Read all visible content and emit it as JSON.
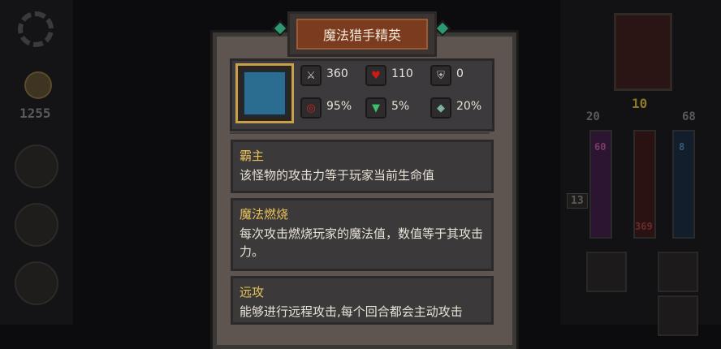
{
  "sidebar_left": {
    "gold": "1255"
  },
  "right_panel": {
    "level": "10",
    "attack": "20",
    "defense": "68",
    "red_stat": "60",
    "blue_stat": "8",
    "hp_display": "369",
    "floor": "13"
  },
  "monster": {
    "name": "魔法猎手精英",
    "stats": [
      {
        "icon": "sword-icon",
        "value": "360",
        "color": "#c9c9c9"
      },
      {
        "icon": "heart-icon",
        "value": "110",
        "color": "#d01a1a"
      },
      {
        "icon": "shield-icon",
        "value": "0",
        "color": "#b9b9b9"
      },
      {
        "icon": "target-icon",
        "value": "95%",
        "color": "#d02424"
      },
      {
        "icon": "tornado-icon",
        "value": "5%",
        "color": "#3fbf6a"
      },
      {
        "icon": "crest-icon",
        "value": "20%",
        "color": "#7fb3a0"
      }
    ],
    "skills": [
      {
        "title": "霸主",
        "desc": "该怪物的攻击力等于玩家当前生命值"
      },
      {
        "title": "魔法燃烧",
        "desc": "每次攻击燃烧玩家的魔法值，数值等于其攻击力。"
      },
      {
        "title": "远攻",
        "desc": "能够进行远程攻击,每个回合都会主动攻击"
      }
    ]
  }
}
